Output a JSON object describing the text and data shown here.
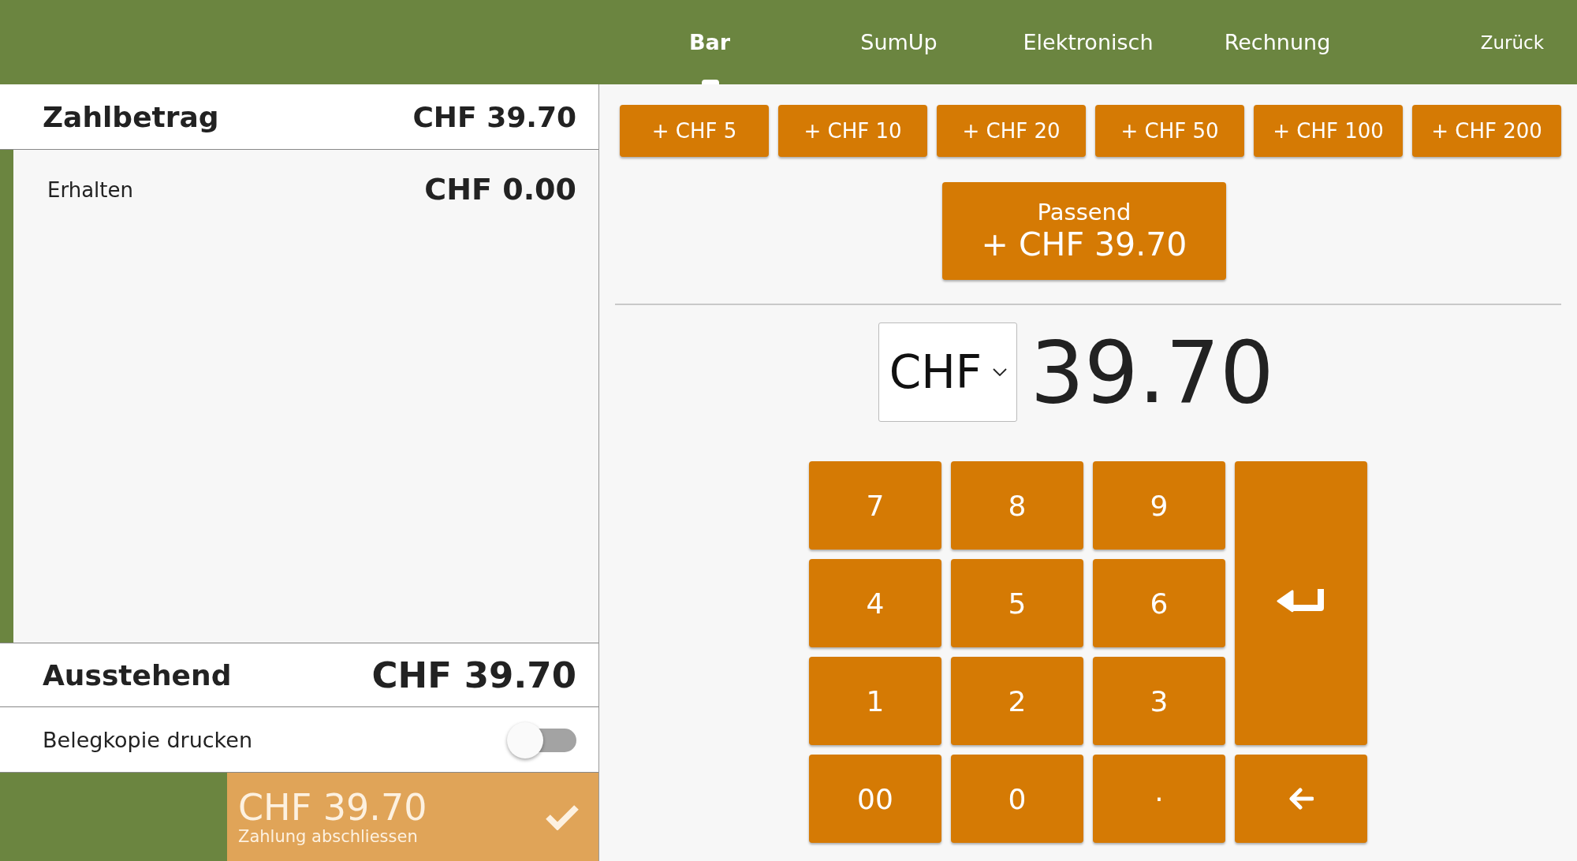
{
  "tabs": [
    {
      "label": "Bar",
      "selected": true
    },
    {
      "label": "SumUp",
      "selected": false
    },
    {
      "label": "Elektronisch",
      "selected": false
    },
    {
      "label": "Rechnung",
      "selected": false
    }
  ],
  "back_link": "Zurück",
  "summary": {
    "due_label": "Zahlbetrag",
    "due_amount": "CHF 39.70",
    "received_label": "Erhalten",
    "received_amount": "CHF 0.00",
    "outstanding_label": "Ausstehend",
    "outstanding_amount": "CHF 39.70"
  },
  "receipt_copy": {
    "label": "Belegkopie drucken",
    "on": false
  },
  "finish_button": {
    "amount": "CHF 39.70",
    "label": "Zahlung abschliessen",
    "disabled": true
  },
  "quick_amounts": [
    "+ CHF 5",
    "+ CHF 10",
    "+ CHF 20",
    "+ CHF 50",
    "+ CHF 100",
    "+ CHF 200"
  ],
  "exact_button": {
    "label": "Passend",
    "amount": "+ CHF 39.70"
  },
  "currency_select": {
    "value": "CHF"
  },
  "amount_display": "39.70",
  "keypad": [
    {
      "kind": "text",
      "label": "7"
    },
    {
      "kind": "text",
      "label": "8"
    },
    {
      "kind": "text",
      "label": "9"
    },
    {
      "kind": "enter"
    },
    {
      "kind": "text",
      "label": "4"
    },
    {
      "kind": "text",
      "label": "5"
    },
    {
      "kind": "text",
      "label": "6"
    },
    {
      "kind": "text",
      "label": "1"
    },
    {
      "kind": "text",
      "label": "2"
    },
    {
      "kind": "text",
      "label": "3"
    },
    {
      "kind": "text",
      "label": "00"
    },
    {
      "kind": "text",
      "label": "0"
    },
    {
      "kind": "text",
      "label": "·"
    },
    {
      "kind": "backspace"
    }
  ]
}
